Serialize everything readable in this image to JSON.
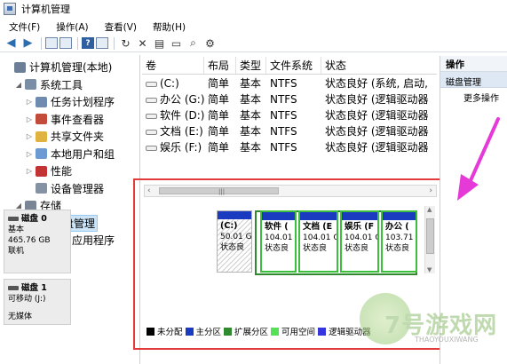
{
  "window": {
    "title": "计算机管理"
  },
  "menu": [
    "文件(F)",
    "操作(A)",
    "查看(V)",
    "帮助(H)"
  ],
  "tree": [
    {
      "label": "计算机管理(本地)",
      "level": 0,
      "expander": "",
      "icon": "computer-icon",
      "color": "#6d7f96"
    },
    {
      "label": "系统工具",
      "level": 1,
      "expander": "◢",
      "icon": "tools-icon",
      "color": "#7a8ea6"
    },
    {
      "label": "任务计划程序",
      "level": 2,
      "expander": "▷",
      "icon": "clock-icon",
      "color": "#6f8bb0"
    },
    {
      "label": "事件查看器",
      "level": 2,
      "expander": "▷",
      "icon": "event-viewer-icon",
      "color": "#c24b3a"
    },
    {
      "label": "共享文件夹",
      "level": 2,
      "expander": "▷",
      "icon": "shared-folder-icon",
      "color": "#e0b240"
    },
    {
      "label": "本地用户和组",
      "level": 2,
      "expander": "▷",
      "icon": "users-icon",
      "color": "#6b9bd2"
    },
    {
      "label": "性能",
      "level": 2,
      "expander": "▷",
      "icon": "performance-icon",
      "color": "#c23434"
    },
    {
      "label": "设备管理器",
      "level": 2,
      "expander": "",
      "icon": "device-manager-icon",
      "color": "#8592a3"
    },
    {
      "label": "存储",
      "level": 1,
      "expander": "◢",
      "icon": "storage-icon",
      "color": "#7a8696"
    },
    {
      "label": "磁盘管理",
      "level": 2,
      "expander": "",
      "icon": "disk-management-icon",
      "color": "#7d8a9a",
      "selected": true
    },
    {
      "label": "服务和应用程序",
      "level": 1,
      "expander": "▷",
      "icon": "services-icon",
      "color": "#7b90a8"
    }
  ],
  "columns": [
    "卷",
    "布局",
    "类型",
    "文件系统",
    "状态"
  ],
  "volumes": [
    {
      "name": "(C:)",
      "layout": "简单",
      "type": "基本",
      "fs": "NTFS",
      "status": "状态良好 (系统, 启动,"
    },
    {
      "name": "办公 (G:)",
      "layout": "简单",
      "type": "基本",
      "fs": "NTFS",
      "status": "状态良好 (逻辑驱动器"
    },
    {
      "name": "软件 (D:)",
      "layout": "简单",
      "type": "基本",
      "fs": "NTFS",
      "status": "状态良好 (逻辑驱动器"
    },
    {
      "name": "文档 (E:)",
      "layout": "简单",
      "type": "基本",
      "fs": "NTFS",
      "status": "状态良好 (逻辑驱动器"
    },
    {
      "name": "娱乐 (F:)",
      "layout": "简单",
      "type": "基本",
      "fs": "NTFS",
      "status": "状态良好 (逻辑驱动器"
    }
  ],
  "disks": [
    {
      "name": "磁盘 0",
      "type": "基本",
      "size": "465.76 GB",
      "state": "联机"
    },
    {
      "name": "磁盘 1",
      "type": "可移动 (J:)",
      "size": "",
      "state": "无媒体"
    }
  ],
  "partitions": [
    {
      "name": "(C:)",
      "size": "50.01 G",
      "status": "状态良"
    },
    {
      "name": "软件 (",
      "size": "104.01 (",
      "status": "状态良"
    },
    {
      "name": "文档 (E",
      "size": "104.01 G",
      "status": "状态良"
    },
    {
      "name": "娱乐 (F",
      "size": "104.01 G",
      "status": "状态良"
    },
    {
      "name": "办公 (",
      "size": "103.71 (",
      "status": "状态良"
    }
  ],
  "legend": [
    {
      "label": "未分配",
      "color": "#000000"
    },
    {
      "label": "主分区",
      "color": "#1a3bbf"
    },
    {
      "label": "扩展分区",
      "color": "#2f8a2f"
    },
    {
      "label": "可用空间",
      "color": "#55e055"
    },
    {
      "label": "逻辑驱动器",
      "color": "#3535e0"
    }
  ],
  "actions": {
    "title": "操作",
    "section": "磁盘管理",
    "more": "更多操作"
  },
  "watermark": {
    "text": "7号游戏网",
    "sub": "THAOYOUXIWANG"
  },
  "colors": {
    "highlight_box": "#e23b3b",
    "arrow": "#e63ad8",
    "primary": "#1a3bbf",
    "extended": "#2f8a2f",
    "logical": "#3cbf3c"
  }
}
